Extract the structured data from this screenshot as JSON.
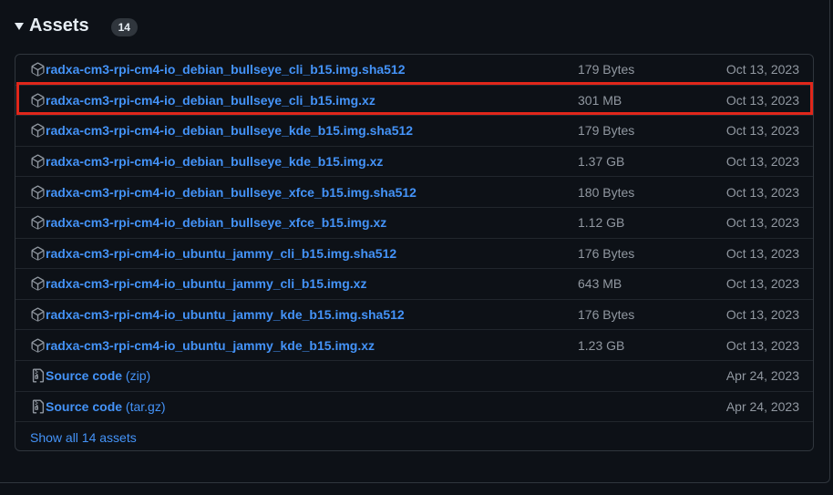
{
  "assets": {
    "title": "Assets",
    "count": "14",
    "items": [
      {
        "name": "radxa-cm3-rpi-cm4-io_debian_bullseye_cli_b15.img.sha512",
        "size": "179 Bytes",
        "date": "Oct 13, 2023"
      },
      {
        "name": "radxa-cm3-rpi-cm4-io_debian_bullseye_cli_b15.img.xz",
        "size": "301 MB",
        "date": "Oct 13, 2023"
      },
      {
        "name": "radxa-cm3-rpi-cm4-io_debian_bullseye_kde_b15.img.sha512",
        "size": "179 Bytes",
        "date": "Oct 13, 2023"
      },
      {
        "name": "radxa-cm3-rpi-cm4-io_debian_bullseye_kde_b15.img.xz",
        "size": "1.37 GB",
        "date": "Oct 13, 2023"
      },
      {
        "name": "radxa-cm3-rpi-cm4-io_debian_bullseye_xfce_b15.img.sha512",
        "size": "180 Bytes",
        "date": "Oct 13, 2023"
      },
      {
        "name": "radxa-cm3-rpi-cm4-io_debian_bullseye_xfce_b15.img.xz",
        "size": "1.12 GB",
        "date": "Oct 13, 2023"
      },
      {
        "name": "radxa-cm3-rpi-cm4-io_ubuntu_jammy_cli_b15.img.sha512",
        "size": "176 Bytes",
        "date": "Oct 13, 2023"
      },
      {
        "name": "radxa-cm3-rpi-cm4-io_ubuntu_jammy_cli_b15.img.xz",
        "size": "643 MB",
        "date": "Oct 13, 2023"
      },
      {
        "name": "radxa-cm3-rpi-cm4-io_ubuntu_jammy_kde_b15.img.sha512",
        "size": "176 Bytes",
        "date": "Oct 13, 2023"
      },
      {
        "name": "radxa-cm3-rpi-cm4-io_ubuntu_jammy_kde_b15.img.xz",
        "size": "1.23 GB",
        "date": "Oct 13, 2023"
      }
    ],
    "source_code": [
      {
        "name": "Source code",
        "suffix": "(zip)",
        "date": "Apr 24, 2023"
      },
      {
        "name": "Source code",
        "suffix": "(tar.gz)",
        "date": "Apr 24, 2023"
      }
    ],
    "show_all_label": "Show all 14 assets"
  },
  "icons": {
    "package": "package-icon",
    "file_zip": "file-zip-icon",
    "caret": "triangle-down-icon"
  },
  "colors": {
    "link": "#4493f8",
    "muted": "#9198a1",
    "highlight": "#e0271b"
  },
  "highlighted_asset": "radxa-cm3-rpi-cm4-io_debian_bullseye_cli_b15.img.xz"
}
